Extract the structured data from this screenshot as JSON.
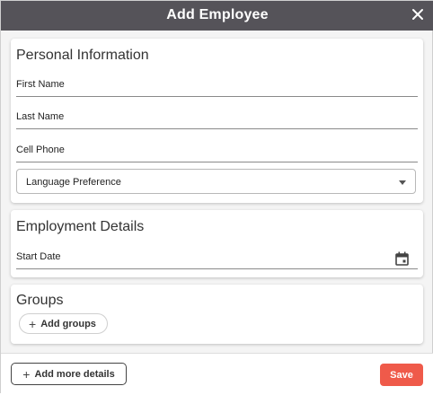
{
  "dialog": {
    "title": "Add Employee",
    "close_icon": "close-icon"
  },
  "personal": {
    "heading": "Personal Information",
    "first_name_label": "First Name",
    "last_name_label": "Last Name",
    "cell_phone_label": "Cell Phone",
    "language_select_value": "Language Preference",
    "select_icon": "chevron-down-icon"
  },
  "employment": {
    "heading": "Employment Details",
    "start_date_label": "Start Date",
    "date_icon": "calendar-icon"
  },
  "groups": {
    "heading": "Groups",
    "add_groups_label": "Add groups",
    "add_icon": "plus-icon"
  },
  "footer": {
    "add_more_details_label": "Add more details",
    "save_label": "Save"
  },
  "colors": {
    "header_bg": "#555359",
    "save_bg": "#ef5a4a"
  }
}
